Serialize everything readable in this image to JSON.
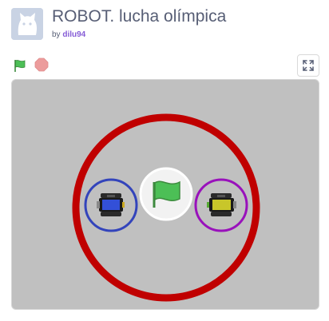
{
  "project": {
    "title": "ROBOT. lucha olímpica",
    "by_prefix": "by",
    "author": "dilu94"
  },
  "controls": {
    "green_flag_icon": "green-flag-icon",
    "stop_icon": "stop-sign-icon",
    "fullscreen_icon": "fullscreen-icon"
  },
  "colors": {
    "stage_background": "#c0c0c0",
    "arena_ring": "#c00000",
    "left_robot_ring": "#3344bb",
    "right_robot_ring": "#9911bb",
    "flag_green": "#4cbf56",
    "author_link": "#855cd6",
    "title_text": "#575e75"
  }
}
